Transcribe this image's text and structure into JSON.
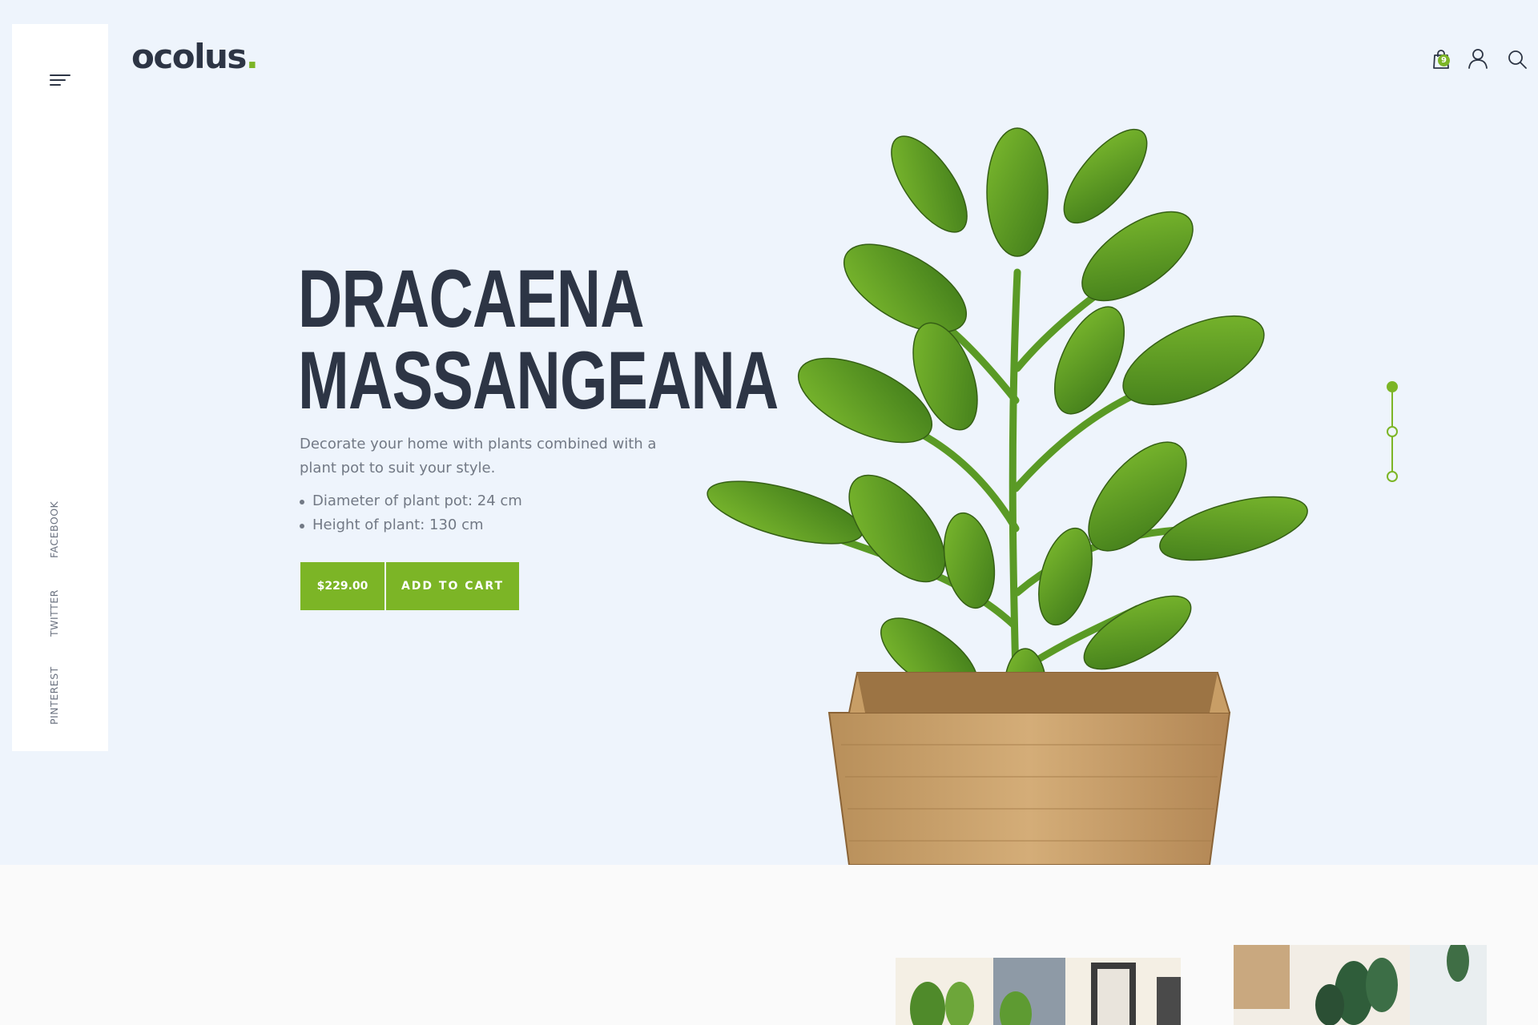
{
  "brand": {
    "name": "ocolus",
    "dot": ".",
    "accent": "#7cb526"
  },
  "header": {
    "cart_count": "9"
  },
  "social": {
    "facebook": "FACEBOOK",
    "twitter": "TWITTER",
    "pinterest": "PINTEREST"
  },
  "hero": {
    "title_line1": "DRACAENA",
    "title_line2": "MASSANGEANA",
    "description": "Decorate your home with plants combined with a plant pot to suit your style.",
    "specs": [
      "Diameter of plant pot: 24 cm",
      "Height of plant: 130 cm"
    ],
    "price": "$229.00",
    "add_to_cart": "ADD TO CART"
  },
  "slider": {
    "count": 3,
    "active_index": 0
  },
  "icons": [
    "menu-icon",
    "shopping-bag-icon",
    "user-icon",
    "search-icon"
  ],
  "colors": {
    "hero_bg": "#eef4fc",
    "heading": "#2d3545",
    "body_text": "#727985"
  }
}
